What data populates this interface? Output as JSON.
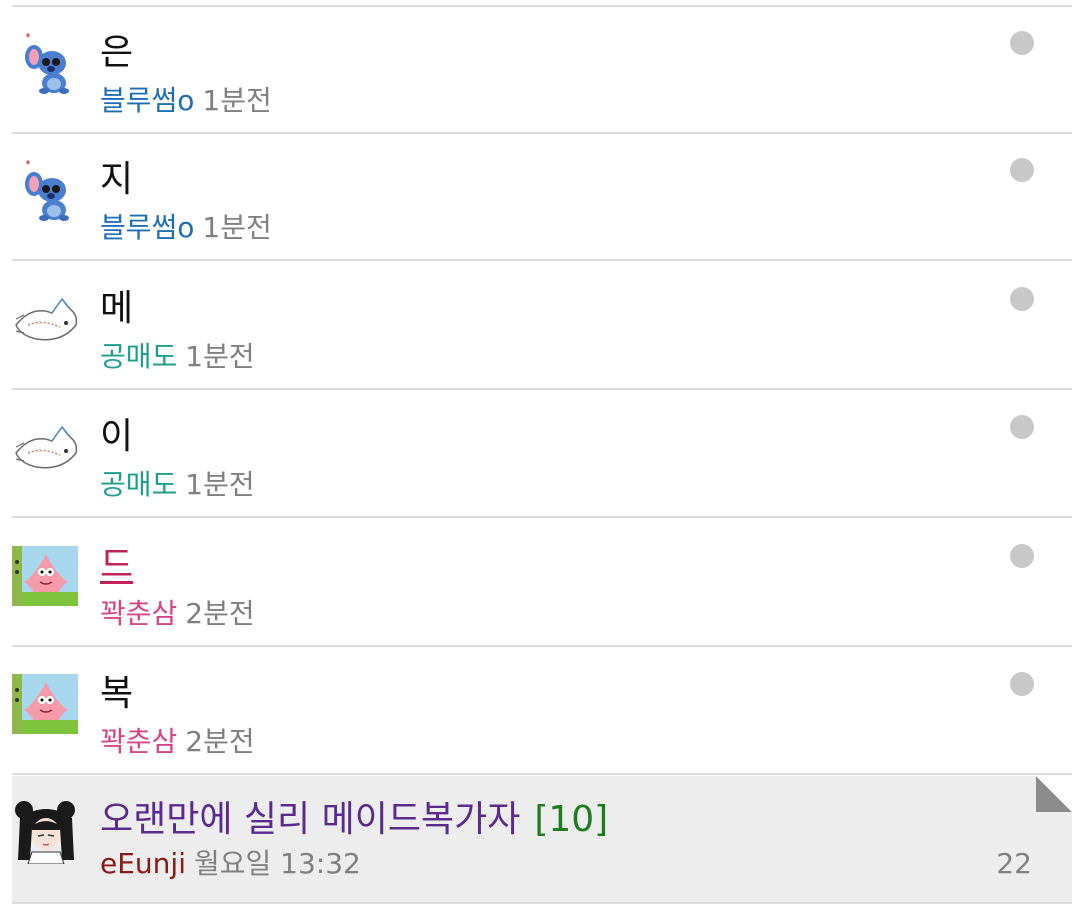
{
  "comments": [
    {
      "text": "은",
      "author": "블루썸o",
      "time": "1분전",
      "author_color": "#1f6fb5",
      "avatar": "stitch-avatar"
    },
    {
      "text": "지",
      "author": "블루썸o",
      "time": "1분전",
      "author_color": "#1f6fb5",
      "avatar": "stitch-avatar"
    },
    {
      "text": "메",
      "author": "공매도",
      "time": "1분전",
      "author_color": "#1f9e8f",
      "avatar": "fish-sketch-avatar"
    },
    {
      "text": "이",
      "author": "공매도",
      "time": "1분전",
      "author_color": "#1f9e8f",
      "avatar": "fish-sketch-avatar"
    },
    {
      "text": "드",
      "author": "꽉춘삼",
      "time": "2분전",
      "author_color": "#d6458b",
      "avatar": "patrick-avatar"
    },
    {
      "text": "복",
      "author": "꽉춘삼",
      "time": "2분전",
      "author_color": "#d6458b",
      "avatar": "patrick-avatar"
    }
  ],
  "post": {
    "title": "오랜만에 실리 메이드복가자",
    "comment_count": "[10]",
    "author": "eEunji",
    "time": "월요일 13:32",
    "number": "22"
  },
  "colors": {
    "post_title": "#5a2a8e",
    "post_count": "#1e7d1e",
    "post_author": "#8b1a1a",
    "linked_comment": "#c0235a"
  }
}
